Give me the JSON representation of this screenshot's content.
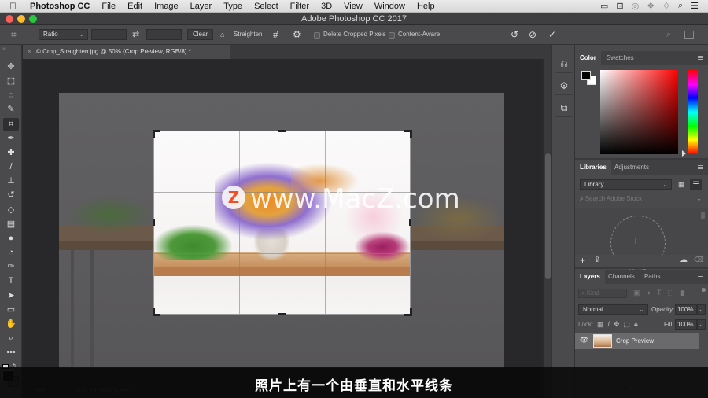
{
  "menubar": {
    "app_name": "Photoshop CC",
    "items": [
      "File",
      "Edit",
      "Image",
      "Layer",
      "Type",
      "Select",
      "Filter",
      "3D",
      "View",
      "Window",
      "Help"
    ],
    "status_icons": [
      "display-icon",
      "screen-record-icon",
      "creative-cloud-icon",
      "dropbox-icon",
      "wifi-icon",
      "spotlight-search-icon",
      "notification-list-icon"
    ]
  },
  "window": {
    "title": "Adobe Photoshop CC 2017"
  },
  "options_bar": {
    "tool_icon": "crop-icon",
    "ratio_select": "Ratio",
    "width_value": "",
    "height_value": "",
    "swap_icon": "swap-arrows-icon",
    "clear_label": "Clear",
    "straighten_label": "Straighten",
    "overlay_icon": "grid-overlay-icon",
    "settings_icon": "gear-icon",
    "delete_cropped_label": "Delete Cropped Pixels",
    "delete_cropped_checked": false,
    "content_aware_label": "Content-Aware",
    "content_aware_checked": false,
    "reset_icon": "reset-icon",
    "cancel_icon": "cancel-icon",
    "commit_icon": "checkmark-icon",
    "search_icon": "search-icon",
    "workspace_icon": "workspace-icon"
  },
  "document": {
    "tab_title": "© Crop_Straighten.jpg @ 50% (Crop Preview, RGB/8) *",
    "close_glyph": "×",
    "watermark": "www.MacZ.com",
    "watermark_logo": "Z",
    "zoom_level": "50%",
    "doc_size": "Doc: 19.9M/0 bytes"
  },
  "toolbox": {
    "tools": [
      {
        "name": "move-tool",
        "glyph": "✥"
      },
      {
        "name": "marquee-tool",
        "glyph": "⬚"
      },
      {
        "name": "lasso-tool",
        "glyph": "◌"
      },
      {
        "name": "quick-select-tool",
        "glyph": "✎"
      },
      {
        "name": "crop-tool",
        "glyph": "⌗",
        "active": true
      },
      {
        "name": "eyedropper-tool",
        "glyph": "✒"
      },
      {
        "name": "healing-brush-tool",
        "glyph": "✚"
      },
      {
        "name": "brush-tool",
        "glyph": "/"
      },
      {
        "name": "clone-stamp-tool",
        "glyph": "⊥"
      },
      {
        "name": "history-brush-tool",
        "glyph": "↺"
      },
      {
        "name": "eraser-tool",
        "glyph": "◇"
      },
      {
        "name": "gradient-tool",
        "glyph": "▤"
      },
      {
        "name": "blur-tool",
        "glyph": "●"
      },
      {
        "name": "dodge-tool",
        "glyph": "◔"
      },
      {
        "name": "pen-tool",
        "glyph": "✑"
      },
      {
        "name": "type-tool",
        "glyph": "T"
      },
      {
        "name": "path-selection-tool",
        "glyph": "➤"
      },
      {
        "name": "rectangle-tool",
        "glyph": "▭"
      },
      {
        "name": "hand-tool",
        "glyph": "✋"
      },
      {
        "name": "zoom-tool",
        "glyph": "⌕"
      },
      {
        "name": "more-tools",
        "glyph": "•••"
      }
    ],
    "foreground_color": "#000000",
    "background_color": "#3a3a3a"
  },
  "icon_strip": [
    "history-icon",
    "properties-icon",
    "artboard-icon"
  ],
  "color_panel": {
    "tabs": [
      "Color",
      "Swatches"
    ],
    "active_tab": "Color",
    "foreground": "#000000",
    "background": "#ffffff",
    "hue_color": "#ff0000"
  },
  "libraries_panel": {
    "tabs": [
      "Libraries",
      "Adjustments"
    ],
    "active_tab": "Libraries",
    "library_select": "Library",
    "search_placeholder": "Search Adobe Stock",
    "add_glyph": "+",
    "upload_glyph": "⇪",
    "sync_glyph": "☁",
    "trash_glyph": "🗑"
  },
  "layers_panel": {
    "tabs": [
      "Layers",
      "Channels",
      "Paths"
    ],
    "active_tab": "Layers",
    "filter_placeholder": "Kind",
    "blend_mode": "Normal",
    "opacity_label": "Opacity:",
    "opacity_value": "100%",
    "lock_label": "Lock:",
    "fill_label": "Fill:",
    "fill_value": "100%",
    "layers": [
      {
        "name": "Crop Preview",
        "visible": true
      }
    ],
    "footer_icons": [
      "link-icon",
      "fx-icon",
      "mask-icon",
      "adjustment-icon",
      "folder-icon",
      "new-layer-icon",
      "trash-icon"
    ]
  },
  "subtitle": "照片上有一个由垂直和水平线条"
}
